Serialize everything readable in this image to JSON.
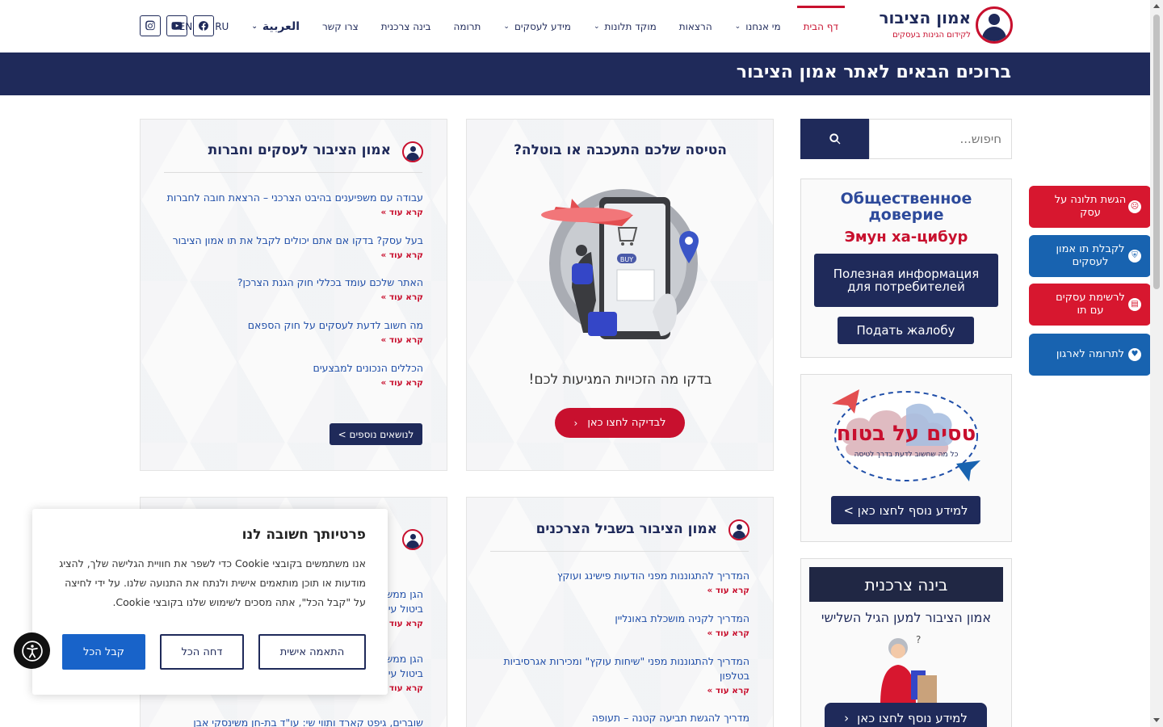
{
  "header": {
    "logo_title": "אמון הציבור",
    "logo_subtitle": "לקידום הגינות בעסקים",
    "nav": [
      {
        "label": "דף הבית",
        "caret": false,
        "active": true
      },
      {
        "label": "מי אנחנו",
        "caret": true
      },
      {
        "label": "הרצאות",
        "caret": false
      },
      {
        "label": "מוקד תלונות",
        "caret": true
      },
      {
        "label": "מידע לעסקים",
        "caret": true
      },
      {
        "label": "תרומה",
        "caret": false
      },
      {
        "label": "בינה צרכנית",
        "caret": false
      },
      {
        "label": "צרו קשר",
        "caret": false
      },
      {
        "label": "العربية",
        "caret": true
      },
      {
        "label": "RU",
        "caret": false
      },
      {
        "label": "EN",
        "caret": false
      }
    ]
  },
  "banner": {
    "title": "ברוכים הבאים לאתר אמון הציבור"
  },
  "search": {
    "placeholder": "חיפוש..."
  },
  "business_card": {
    "title": "אמון הציבור לעסקים וחברות",
    "items": [
      {
        "text": "עבודה עם משפיענים בהיבט הצרכני – הרצאת חובה לחברות",
        "more": "קרא עוד »"
      },
      {
        "text": "בעל עסק? בדקו אם אתם יכולים לקבל את תו אמון הציבור",
        "more": "קרא עוד »"
      },
      {
        "text": "האתר שלכם עומד בכללי חוק הגנת הצרכן?",
        "more": "קרא עוד »"
      },
      {
        "text": "מה חשוב לדעת לעסקים על חוק הספאם",
        "more": "קרא עוד »"
      },
      {
        "text": "הכללים הנכונים למבצעים",
        "more": "קרא עוד »"
      }
    ],
    "more_button": "לנושאים נוספים >"
  },
  "flight_card": {
    "title": "הטיסה שלכם התעכבה או בוטלה?",
    "text": "בדקו מה הזכויות המגיעות לכם!",
    "button": "לבדיקה לחצו כאן",
    "image_label": "BUY"
  },
  "consumer_card": {
    "title": "אמון הציבור בשביל הצרכנים",
    "items": [
      {
        "text": "המדריך להתגוננות מפני הודעות פישינג ועוקץ",
        "more": "קרא עוד »"
      },
      {
        "text": "המדריך לקניה מושכלת באונליין",
        "more": "קרא עוד »"
      },
      {
        "text": "המדריך להתגוננות מפני \"שיחות עוקץ\" ומכירות אגרסיביות בטלפון",
        "more": "קרא עוד »"
      },
      {
        "text": "מדריך להגשת תביעה קטנה – תעופה",
        "more": ""
      }
    ]
  },
  "hidden_card": {
    "items": [
      {
        "text": "הגן ממש ביטול עי",
        "more": "קרא עוד »"
      },
      {
        "text": "הגן ממש ביטול עי",
        "more": "קרא עוד »"
      },
      {
        "text": "שוברים, גיפט קארד ותווי שי: עו\"ד בת-חן משינסקי אבן",
        "more": ""
      }
    ]
  },
  "russian_box": {
    "title": "Общественное доверие",
    "subtitle": "Эмун ха-цибур",
    "button1": "Полезная информация для потребителей",
    "button2": "Подать жалобу"
  },
  "flights_box": {
    "logo_text": "טסים על בטוח",
    "logo_sub": "כל מה שחשוב לדעת בדרך לטיסה",
    "button": "למידע נוסף לחצו כאן >"
  },
  "wisdom_box": {
    "title": "בינה צרכנית",
    "subtitle": "אמון הציבור למען הגיל השלישי",
    "button": "למידע נוסף לחצו כאן"
  },
  "side_tabs": [
    {
      "label": "הגשת תלונה על עסק",
      "icon": "sad-face-icon",
      "color": "#d7172f"
    },
    {
      "label": "לקבלת תו אמון לעסקים",
      "icon": "shield-icon",
      "color": "#1863b0"
    },
    {
      "label": "לרשימת עסקים עם תו",
      "icon": "store-icon",
      "color": "#d7172f"
    },
    {
      "label": "לתרומה לארגון",
      "icon": "heart-icon",
      "color": "#1863b0"
    }
  ],
  "cookie": {
    "title": "פרטיותך חשובה לנו",
    "text": "אנו משתמשים בקובצי Cookie כדי לשפר את חוויית הגלישה שלך, להציג מודעות או תוכן מותאמים אישית ולנתח את התנועה שלנו. על ידי לחיצה על \"קבל הכל\", אתה מסכים לשימוש שלנו בקובצי Cookie.",
    "customize": "התאמה אישית",
    "reject": "דחה הכל",
    "accept": "קבל הכל"
  },
  "colors": {
    "navy": "#1f2a5a",
    "red": "#c8102e",
    "blue": "#1863b0",
    "link": "#1f4ea8"
  }
}
